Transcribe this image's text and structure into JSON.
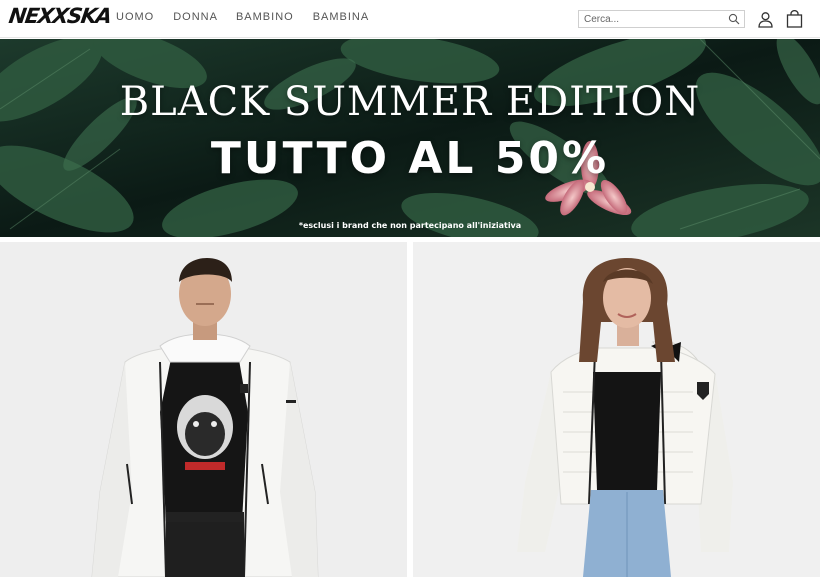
{
  "header": {
    "logo_text": "NEXXSKA",
    "nav": [
      {
        "label": "UOMO"
      },
      {
        "label": "DONNA"
      },
      {
        "label": "BAMBINO"
      },
      {
        "label": "BAMBINA"
      }
    ],
    "search": {
      "placeholder": "Cerca..."
    },
    "icons": {
      "search": "search-icon",
      "account": "user-icon",
      "cart": "shopping-bag-icon"
    }
  },
  "banner": {
    "title": "BLACK SUMMER EDITION",
    "subtitle": "TUTTO AL 50%",
    "note": "*esclusi i brand che non partecipano all'iniziativa"
  },
  "products": [
    {
      "model": "man",
      "jacket_color": "#f4f4f2",
      "shirt": "black dog print tee"
    },
    {
      "model": "woman",
      "jacket_color": "#f2f1ed",
      "shirt": "black crop top"
    }
  ],
  "colors": {
    "accent": "#111111",
    "banner_bg": "#0e1d18",
    "nav_text": "#555555"
  }
}
